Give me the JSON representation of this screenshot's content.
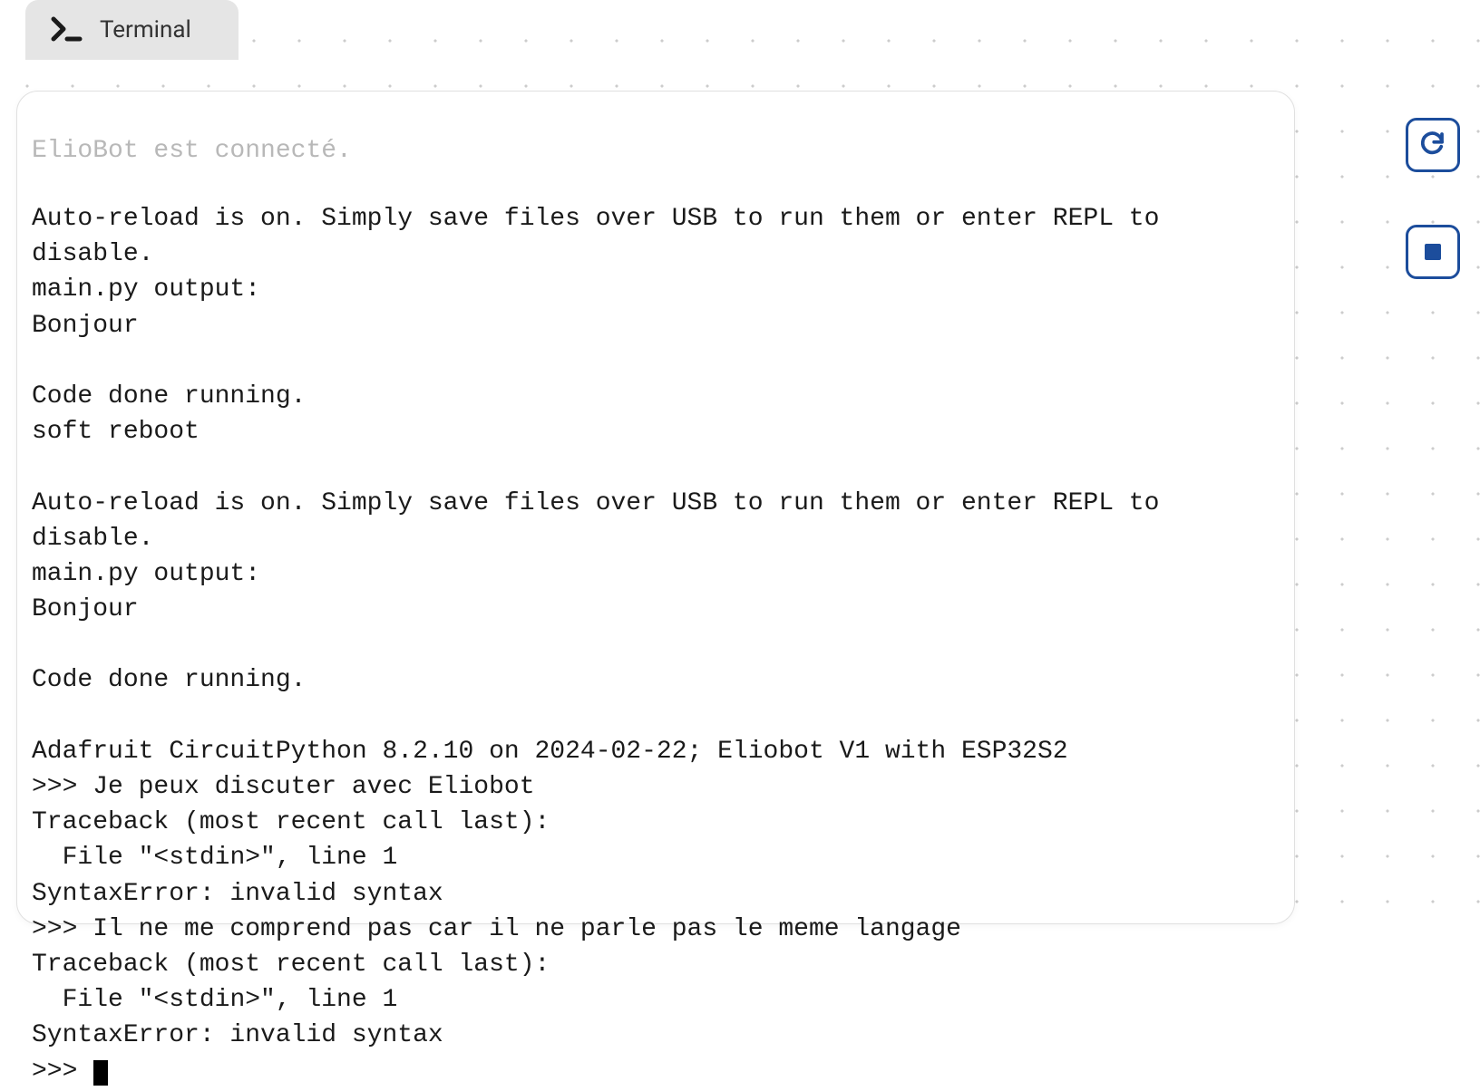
{
  "tab": {
    "label": "Terminal",
    "icon": "terminal-prompt-icon"
  },
  "status": "ElioBot est connecté.",
  "terminal": {
    "lines": [
      "Auto-reload is on. Simply save files over USB to run them or enter REPL to disable.",
      "main.py output:",
      "Bonjour",
      "",
      "Code done running.",
      "soft reboot",
      "",
      "Auto-reload is on. Simply save files over USB to run them or enter REPL to disable.",
      "main.py output:",
      "Bonjour",
      "",
      "Code done running.",
      "",
      "Adafruit CircuitPython 8.2.10 on 2024-02-22; Eliobot V1 with ESP32S2",
      ">>> Je peux discuter avec Eliobot",
      "Traceback (most recent call last):",
      "  File \"<stdin>\", line 1",
      "SyntaxError: invalid syntax",
      ">>> Il ne me comprend pas car il ne parle pas le meme langage",
      "Traceback (most recent call last):",
      "  File \"<stdin>\", line 1",
      "SyntaxError: invalid syntax"
    ],
    "prompt": ">>> "
  },
  "buttons": {
    "refresh": "refresh-icon",
    "stop": "stop-icon"
  },
  "colors": {
    "accent": "#1c4d9c",
    "tab_bg": "#e5e5e5",
    "status_text": "#b8b8b8"
  }
}
